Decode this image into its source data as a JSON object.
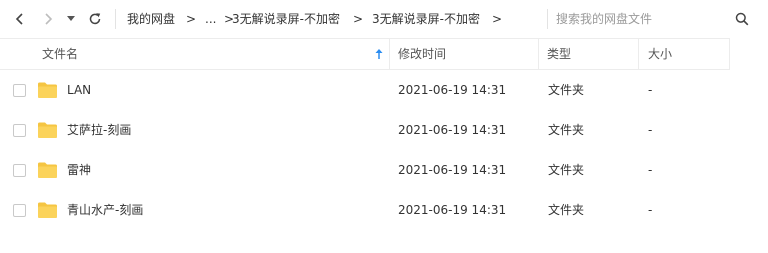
{
  "toolbar": {
    "breadcrumbs": [
      {
        "label": "我的网盘"
      },
      {
        "label": "..."
      },
      {
        "label": "3无解说录屏-不加密"
      },
      {
        "label": "3无解说录屏-不加密"
      }
    ],
    "separator": ">",
    "search_placeholder": "搜索我的网盘文件"
  },
  "columns": {
    "name": "文件名",
    "modified": "修改时间",
    "type": "类型",
    "size": "大小",
    "sort": "modified-ascending"
  },
  "files": [
    {
      "name": "LAN",
      "modified": "2021-06-19 14:31",
      "type": "文件夹",
      "size": "-",
      "icon": "folder-icon"
    },
    {
      "name": "艾萨拉-刻画",
      "modified": "2021-06-19 14:31",
      "type": "文件夹",
      "size": "-",
      "icon": "folder-icon"
    },
    {
      "name": "雷神",
      "modified": "2021-06-19 14:31",
      "type": "文件夹",
      "size": "-",
      "icon": "folder-icon"
    },
    {
      "name": "青山水产-刻画",
      "modified": "2021-06-19 14:31",
      "type": "文件夹",
      "size": "-",
      "icon": "folder-icon"
    }
  ],
  "colors": {
    "folder": "#f5c542",
    "accent": "#2a8cf0"
  }
}
